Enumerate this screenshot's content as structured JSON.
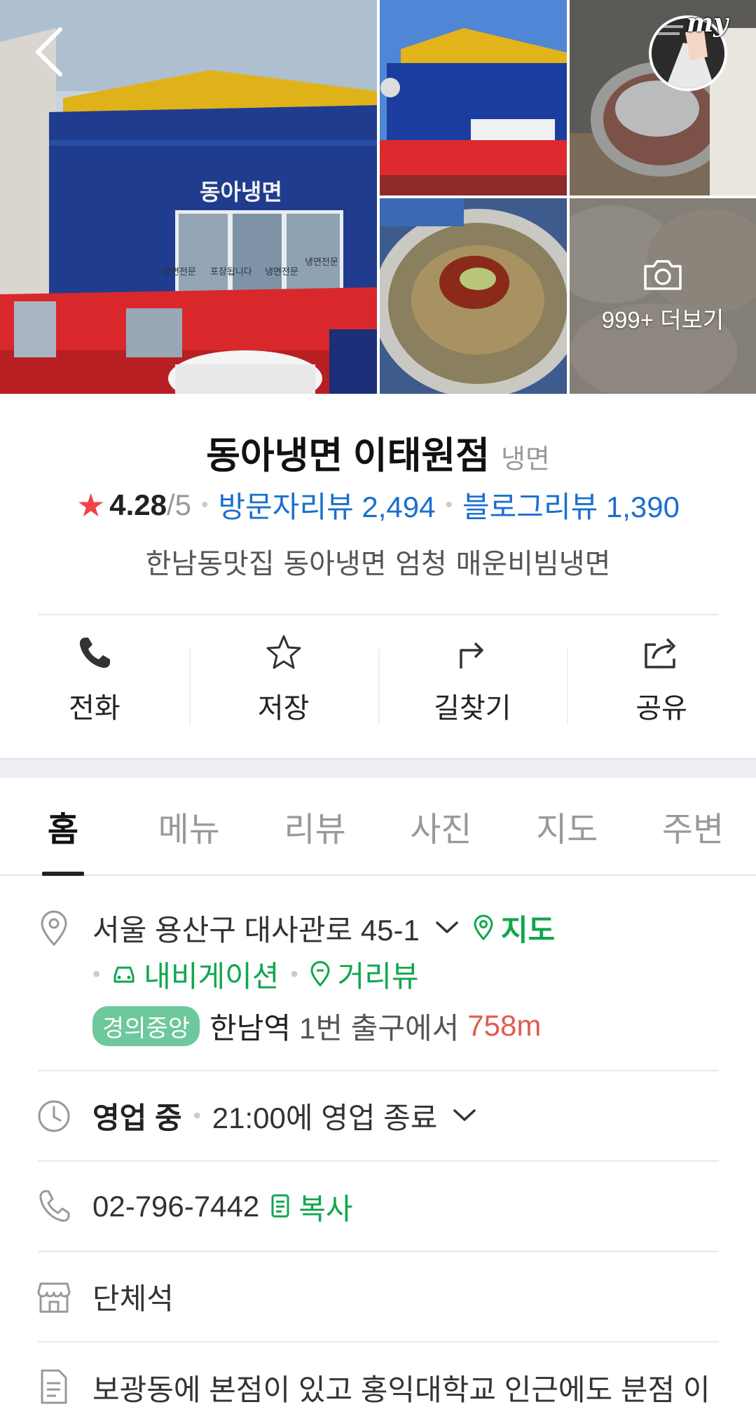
{
  "gallery": {
    "more_label": "999+ 더보기",
    "my_label": "my",
    "storefront_signs": [
      "동아냉면",
      "냉면전문",
      "포장됩니다",
      "냉면전문",
      "냉면전문"
    ]
  },
  "place": {
    "name": "동아냉면 이태원점",
    "category": "냉면",
    "rating": "4.28",
    "rating_max": "/5",
    "visitor_reviews": "방문자리뷰 2,494",
    "blog_reviews": "블로그리뷰 1,390",
    "description": "한남동맛집 동아냉면 엄청 매운비빔냉면"
  },
  "actions": [
    {
      "label": "전화",
      "icon": "phone-icon"
    },
    {
      "label": "저장",
      "icon": "star-icon"
    },
    {
      "label": "길찾기",
      "icon": "directions-icon"
    },
    {
      "label": "공유",
      "icon": "share-icon"
    }
  ],
  "tabs": [
    "홈",
    "메뉴",
    "리뷰",
    "사진",
    "지도",
    "주변"
  ],
  "active_tab": "홈",
  "info": {
    "address": "서울 용산구 대사관로 45-1",
    "map_link": "지도",
    "navigation_link": "내비게이션",
    "street_view_link": "거리뷰",
    "subway_line": "경의중앙",
    "station": "한남역",
    "exit_text": "1번 출구에서",
    "distance": "758m",
    "status": "영업 중",
    "hours": "21:00에 영업 종료",
    "phone": "02-796-7442",
    "copy_label": "복사",
    "amenity": "단체석",
    "about": "보광동에 본점이 있고 홍익대학교 인근에도 분점 이"
  },
  "colors": {
    "link_blue": "#1a6fcf",
    "link_green": "#11a64d",
    "star_red": "#f2444a",
    "distance_red": "#e25b4f",
    "badge_green": "#6dc89b"
  }
}
